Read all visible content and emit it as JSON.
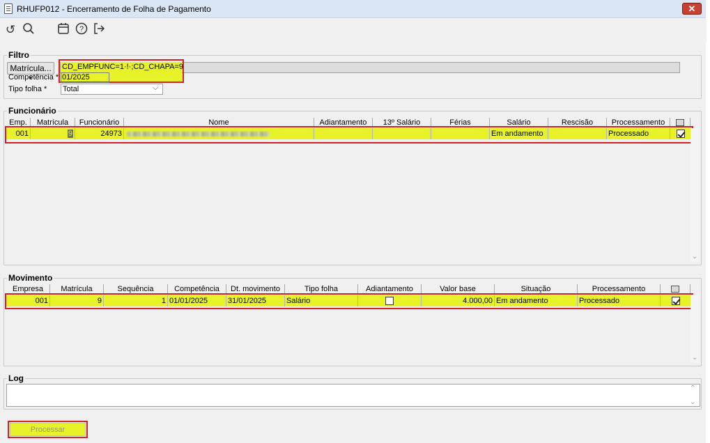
{
  "window": {
    "title": "RHUFP012 - Encerramento de Folha de Pagamento",
    "close": "✕"
  },
  "toolbar": {
    "undo": "↺",
    "search": "⌕",
    "calendar": "📅",
    "help": "?",
    "exit": "↦"
  },
  "filtro": {
    "label": "Filtro",
    "matricula_button": "Matrícula... *",
    "matricula_value": "CD_EMPFUNC=1·!·;CD_CHAPA=9",
    "competencia_label": "Competência *",
    "competencia_value": "01/2025",
    "tipo_folha_label": "Tipo folha *",
    "tipo_folha_value": "Total"
  },
  "funcionario": {
    "label": "Funcionário",
    "columns": [
      "Emp.",
      "Matrícula",
      "Funcionário",
      "Nome",
      "Adiantamento",
      "13º Salário",
      "Férias",
      "Salário",
      "Rescisão",
      "Processamento"
    ],
    "row": {
      "emp": "001",
      "matricula": "9",
      "funcionario": "24973",
      "nome": "",
      "adiantamento": "",
      "decimo": "",
      "ferias": "",
      "salario": "Em andamento",
      "rescisao": "",
      "processamento": "Processado",
      "checked": true
    }
  },
  "movimento": {
    "label": "Movimento",
    "columns": [
      "Empresa",
      "Matrícula",
      "Sequência",
      "Competência",
      "Dt. movimento",
      "Tipo folha",
      "Adiantamento",
      "Valor base",
      "Situação",
      "Processamento"
    ],
    "row": {
      "empresa": "001",
      "matricula": "9",
      "sequencia": "1",
      "competencia": "01/01/2025",
      "dt_movimento": "31/01/2025",
      "tipo_folha": "Salário",
      "adiantamento_checked": false,
      "valor_base": "4.000,00",
      "situacao": "Em andamento",
      "processamento": "Processado",
      "checked": true
    }
  },
  "log": {
    "label": "Log",
    "value": ""
  },
  "actions": {
    "processar": "Processar"
  },
  "colors": {
    "highlight": "#e7f229",
    "annotation": "#d42020"
  }
}
